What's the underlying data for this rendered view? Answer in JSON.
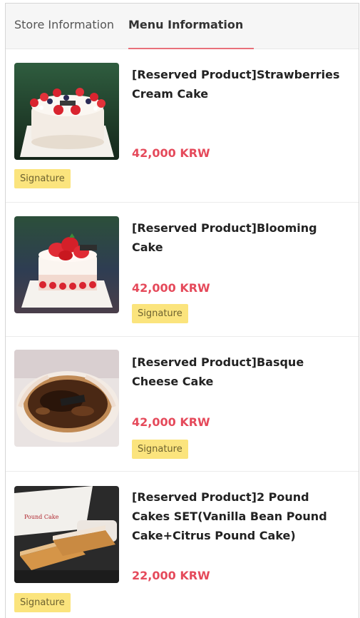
{
  "tabs": {
    "store_label": "Store Information",
    "menu_label": "Menu Information",
    "active": "Menu Information"
  },
  "menu": {
    "items": [
      {
        "name": "[Reserved Product]Strawberries Cream Cake",
        "price": "42,000 KRW",
        "badge": "Signature"
      },
      {
        "name": "[Reserved Product]Blooming Cake",
        "price": "42,000 KRW",
        "badge": "Signature"
      },
      {
        "name": "[Reserved Product]Basque Cheese Cake",
        "price": "42,000 KRW",
        "badge": "Signature"
      },
      {
        "name": "[Reserved Product]2 Pound Cakes SET(Vanilla Bean Pound Cake+Citrus Pound Cake)",
        "price": "22,000 KRW",
        "badge": "Signature"
      }
    ]
  },
  "colors": {
    "price": "#e54a5b",
    "badge_bg": "#fbe47d",
    "tab_indicator": "#e8707a"
  }
}
